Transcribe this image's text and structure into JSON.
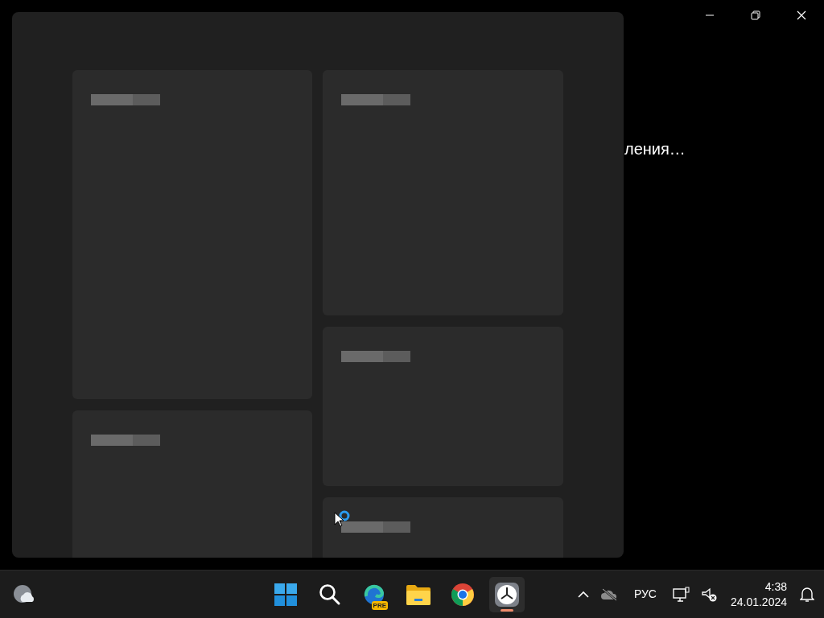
{
  "window_controls": [
    {
      "kind": "minimize"
    },
    {
      "kind": "maximize"
    },
    {
      "kind": "close"
    }
  ],
  "background_text": "ления…",
  "loading_panel": {
    "busy": true
  },
  "taskbar": {
    "weather": {
      "kind": "weather"
    },
    "apps": [
      {
        "kind": "start",
        "selected": false
      },
      {
        "kind": "search",
        "selected": false
      },
      {
        "kind": "edge",
        "badge": "PRE",
        "selected": false
      },
      {
        "kind": "folder",
        "selected": false
      },
      {
        "kind": "chrome",
        "selected": false
      },
      {
        "kind": "clock",
        "selected": true
      }
    ],
    "tray": {
      "language": "РУС",
      "time": "4:38",
      "date": "24.01.2024"
    }
  }
}
